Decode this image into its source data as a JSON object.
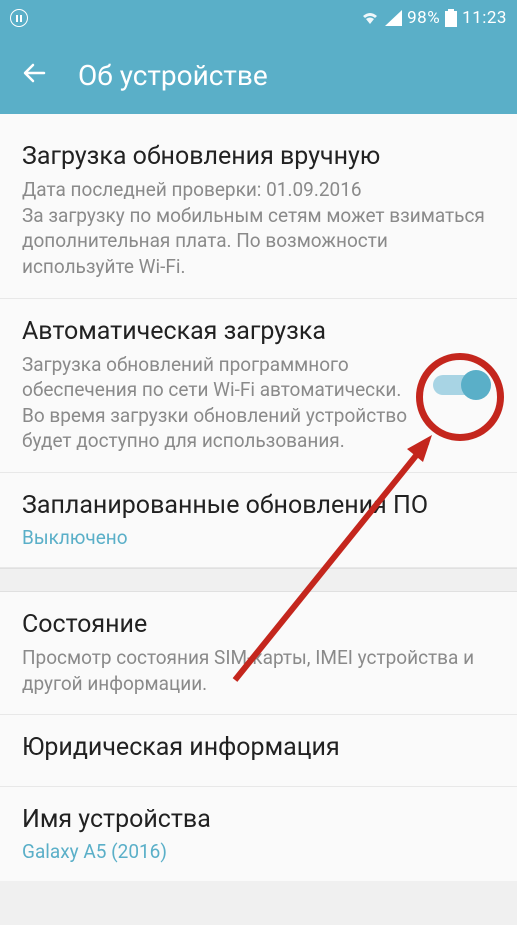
{
  "status_bar": {
    "battery_percent": "98%",
    "time": "11:23"
  },
  "header": {
    "title": "Об устройстве"
  },
  "settings": {
    "manual_download": {
      "title": "Загрузка обновления вручную",
      "description": "Дата последней проверки: 01.09.2016\nЗа загрузку по мобильным сетям может взиматься дополнительная плата. По возможности используйте Wi-Fi."
    },
    "auto_download": {
      "title": "Автоматическая загрузка",
      "description": "Загрузка обновлений программного обеспечения по сети Wi-Fi автоматически. Во время загрузки обновлений устройство будет доступно для использования.",
      "toggle_state": "on"
    },
    "scheduled_updates": {
      "title": "Запланированные обновления ПО",
      "value": "Выключено"
    },
    "status": {
      "title": "Состояние",
      "description": "Просмотр состояния SIM-карты, IMEI устройства и другой информации."
    },
    "legal_info": {
      "title": "Юридическая информация"
    },
    "device_name": {
      "title": "Имя устройства",
      "value": "Galaxy A5 (2016)"
    }
  }
}
